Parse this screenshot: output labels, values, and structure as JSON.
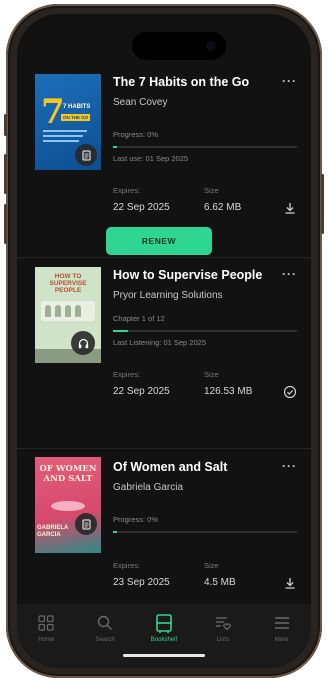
{
  "books": [
    {
      "title": "The 7 Habits on the Go",
      "author": "Sean Covey",
      "progress_text": "Progress: 0%",
      "progress": 0.02,
      "last_use": "Last use: 01 Sep 2025",
      "expires_label": "Expires:",
      "expires": "22 Sep 2025",
      "size_label": "Size",
      "size": "6.62 MB",
      "action_icon": "download-icon",
      "type_icon": "ebook-icon",
      "cover_title": "7 HABITS",
      "cover_sub": "ON THE GO"
    },
    {
      "title": "How to Supervise People",
      "author": "Pryor Learning Solutions",
      "progress_text": "Chapter 1 of 12",
      "progress": 0.08,
      "last_use": "Last Listening: 01 Sep 2025",
      "expires_label": "Expires:",
      "expires": "22 Sep 2025",
      "size_label": "Size",
      "size": "126.53 MB",
      "action_icon": "downloaded-check-icon",
      "type_icon": "headphones-icon",
      "cover_title": "HOW TO SUPERVISE PEOPLE"
    },
    {
      "title": "Of Women and Salt",
      "author": "Gabriela Garcia",
      "progress_text": "Progress: 0%",
      "progress": 0.02,
      "last_use": "",
      "expires_label": "Expires:",
      "expires": "23 Sep 2025",
      "size_label": "Size",
      "size": "4.5 MB",
      "action_icon": "download-icon",
      "type_icon": "ebook-icon",
      "cover_title": "OF WOMEN AND SALT",
      "cover_sub": "GABRIELA GARCIA"
    }
  ],
  "renew_label": "RENEW",
  "more_label": "···",
  "tabs": [
    {
      "label": "Home",
      "icon": "grid-icon",
      "active": false
    },
    {
      "label": "Search",
      "icon": "search-icon",
      "active": false
    },
    {
      "label": "Bookshelf",
      "icon": "bookshelf-icon",
      "active": true
    },
    {
      "label": "Lists",
      "icon": "list-heart-icon",
      "active": false
    },
    {
      "label": "More",
      "icon": "hamburger-icon",
      "active": false
    }
  ],
  "colors": {
    "accent": "#2ed593",
    "background": "#121212",
    "tabbar": "#1a1a1a"
  }
}
